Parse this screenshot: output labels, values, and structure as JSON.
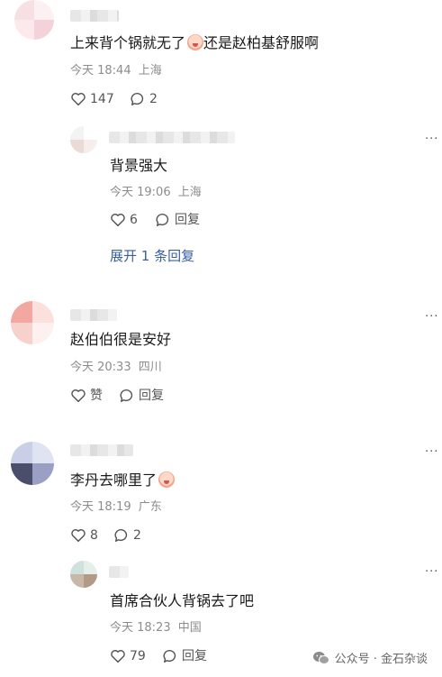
{
  "comments": [
    {
      "text": "上来背个锅就无了",
      "text_after": "还是赵柏基舒服啊",
      "time": "今天 18:44",
      "location": "上海",
      "like_count": "147",
      "reply_count": "2"
    },
    {
      "text": "背景强大",
      "time": "今天 19:06",
      "location": "上海",
      "like_count": "6",
      "reply_label": "回复",
      "expand_label": "展开 1 条回复"
    },
    {
      "text": "赵伯伯很是安好",
      "time": "今天 20:33",
      "location": "四川",
      "like_label": "赞",
      "reply_label": "回复"
    },
    {
      "text": "李丹去哪里了",
      "time": "今天 18:19",
      "location": "广东",
      "like_count": "8",
      "reply_count": "2"
    },
    {
      "text": "首席合伙人背锅去了吧",
      "time": "今天 18:23",
      "location": "中国",
      "like_count": "79",
      "reply_label": "回复"
    }
  ],
  "more_glyph": "···",
  "watermark": "公众号 · 金石杂谈",
  "icons": {
    "like": "heart-outline-icon",
    "reply": "speech-bubble-icon",
    "more": "ellipsis-icon",
    "watermark": "wechat-icon"
  },
  "colors": {
    "link": "#375fa0",
    "meta": "#8c8c8c"
  }
}
